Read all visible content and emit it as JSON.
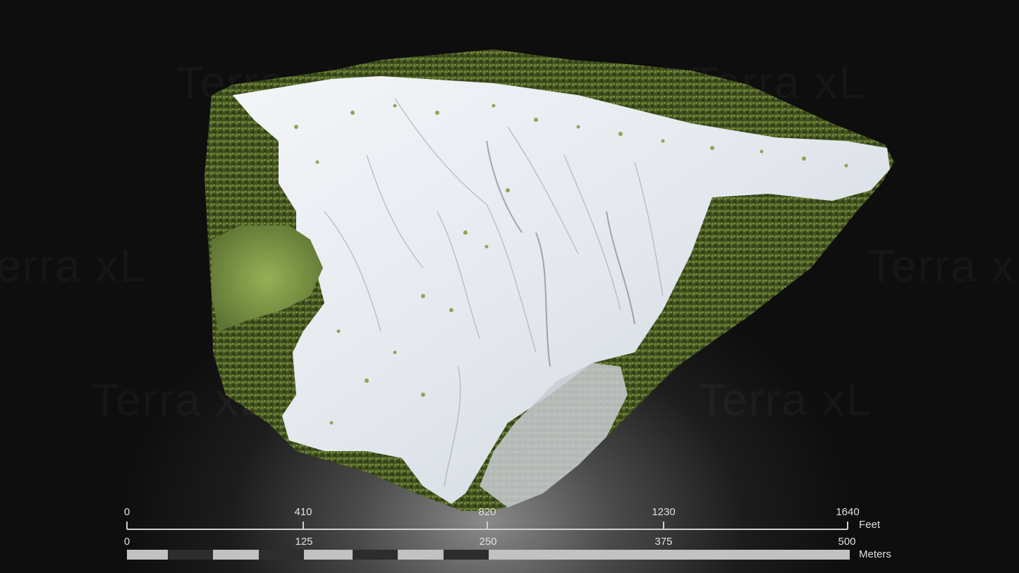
{
  "watermark": {
    "text": "Terra xL"
  },
  "scale_bar": {
    "feet": {
      "ticks": [
        "0",
        "410",
        "820",
        "1230",
        "1640"
      ],
      "unit": "Feet"
    },
    "meters": {
      "ticks": [
        "0",
        "125",
        "250",
        "375",
        "500"
      ],
      "unit": "Meters"
    }
  },
  "image": {
    "subject": "3D photogrammetry model of a mountain summit with snow and conifer forest"
  },
  "colors": {
    "snow": "#e8ecf2",
    "forest": "#4d5e2a",
    "moss": "#7f9a44",
    "background": "#141414"
  }
}
